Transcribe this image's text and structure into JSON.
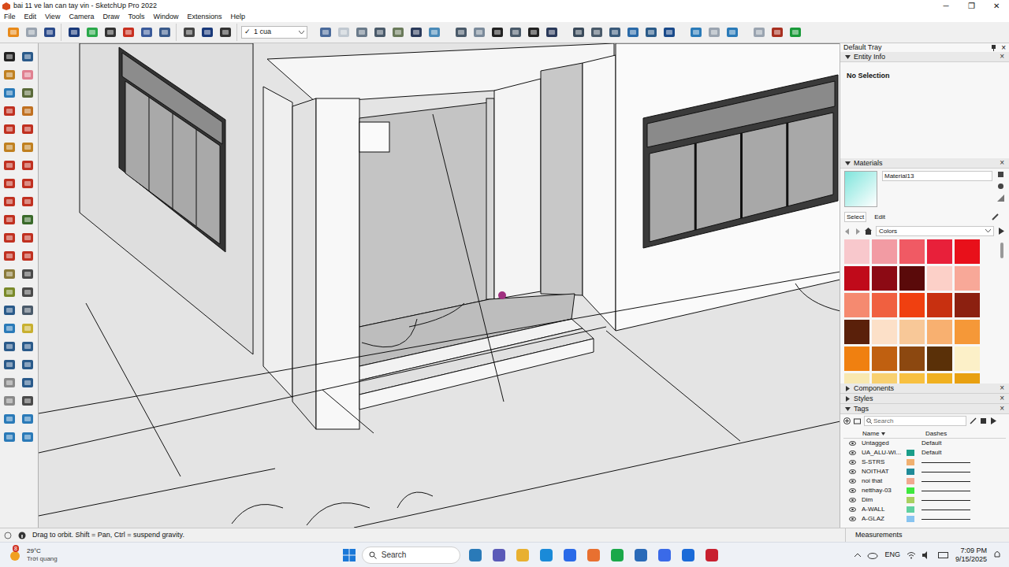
{
  "window": {
    "title": "bai 11 ve lan can tay vin - SketchUp Pro 2022",
    "controls": [
      "─",
      "❐",
      "✕"
    ]
  },
  "menu": [
    "File",
    "Edit",
    "View",
    "Camera",
    "Draw",
    "Tools",
    "Window",
    "Extensions",
    "Help"
  ],
  "toolbar": {
    "scene": {
      "check": "✓",
      "label": "1 cua"
    }
  },
  "tray": {
    "title": "Default Tray",
    "close": "×"
  },
  "entity_info": {
    "title": "Entity Info",
    "expanded": true,
    "text": "No Selection"
  },
  "materials": {
    "title": "Materials",
    "expanded": true,
    "name": "Material13",
    "swatch": "#7fe5dc",
    "tabs": [
      {
        "label": "Select",
        "selected": true
      },
      {
        "label": "Edit",
        "selected": false
      }
    ],
    "library": "Colors",
    "colors": [
      "#f8c8cc",
      "#f29ba3",
      "#f05a64",
      "#e8203a",
      "#e8101a",
      "#c00a1a",
      "#8c0a14",
      "#5a0a0a",
      "#fcd0c8",
      "#f8a898",
      "#f58a70",
      "#f06040",
      "#f04010",
      "#c83010",
      "#8c2010",
      "#5a200a",
      "#fce0c8",
      "#f8c898",
      "#f8b070",
      "#f59838",
      "#f08010",
      "#c06010",
      "#8c4810",
      "#5a3008",
      "#fcf0c8",
      "#f8e8b0",
      "#f8d070",
      "#f8c040",
      "#f0b020",
      "#e8a010"
    ]
  },
  "collapsed_panels": [
    {
      "title": "Components",
      "expanded": false
    },
    {
      "title": "Styles",
      "expanded": false
    }
  ],
  "tags": {
    "title": "Tags",
    "expanded": true,
    "search_placeholder": "Search",
    "columns": [
      "Name",
      "Dashes"
    ],
    "rows": [
      {
        "name": "Untagged",
        "visible": true,
        "color": null,
        "dashes": "Default"
      },
      {
        "name": "UA_ALU-WI...",
        "visible": true,
        "color": "#1a9e8a",
        "dashes": "Default"
      },
      {
        "name": "S-STRS",
        "visible": true,
        "color": "#f0b070",
        "dashes": null
      },
      {
        "name": "NOITHAT",
        "visible": true,
        "color": "#208a98",
        "dashes": null
      },
      {
        "name": "noi that",
        "visible": true,
        "color": "#f0a890",
        "dashes": null
      },
      {
        "name": "netthay-03",
        "visible": true,
        "color": "#3ee83e",
        "dashes": null
      },
      {
        "name": "Dim",
        "visible": true,
        "color": "#a8d060",
        "dashes": null
      },
      {
        "name": "A-WALL",
        "visible": true,
        "color": "#60d0a0",
        "dashes": null
      },
      {
        "name": "A-GLAZ",
        "visible": true,
        "color": "#88c4f0",
        "dashes": null
      }
    ]
  },
  "status_bar": {
    "hint": "Drag to orbit. Shift = Pan, Ctrl = suspend gravity.",
    "measurements": "Measurements"
  },
  "taskbar": {
    "weather": {
      "temp": "29°C",
      "desc": "Trời quang",
      "badge": "8"
    },
    "search": "Search",
    "language": "ENG",
    "time": "7:09 PM",
    "date": "9/15/2025"
  }
}
